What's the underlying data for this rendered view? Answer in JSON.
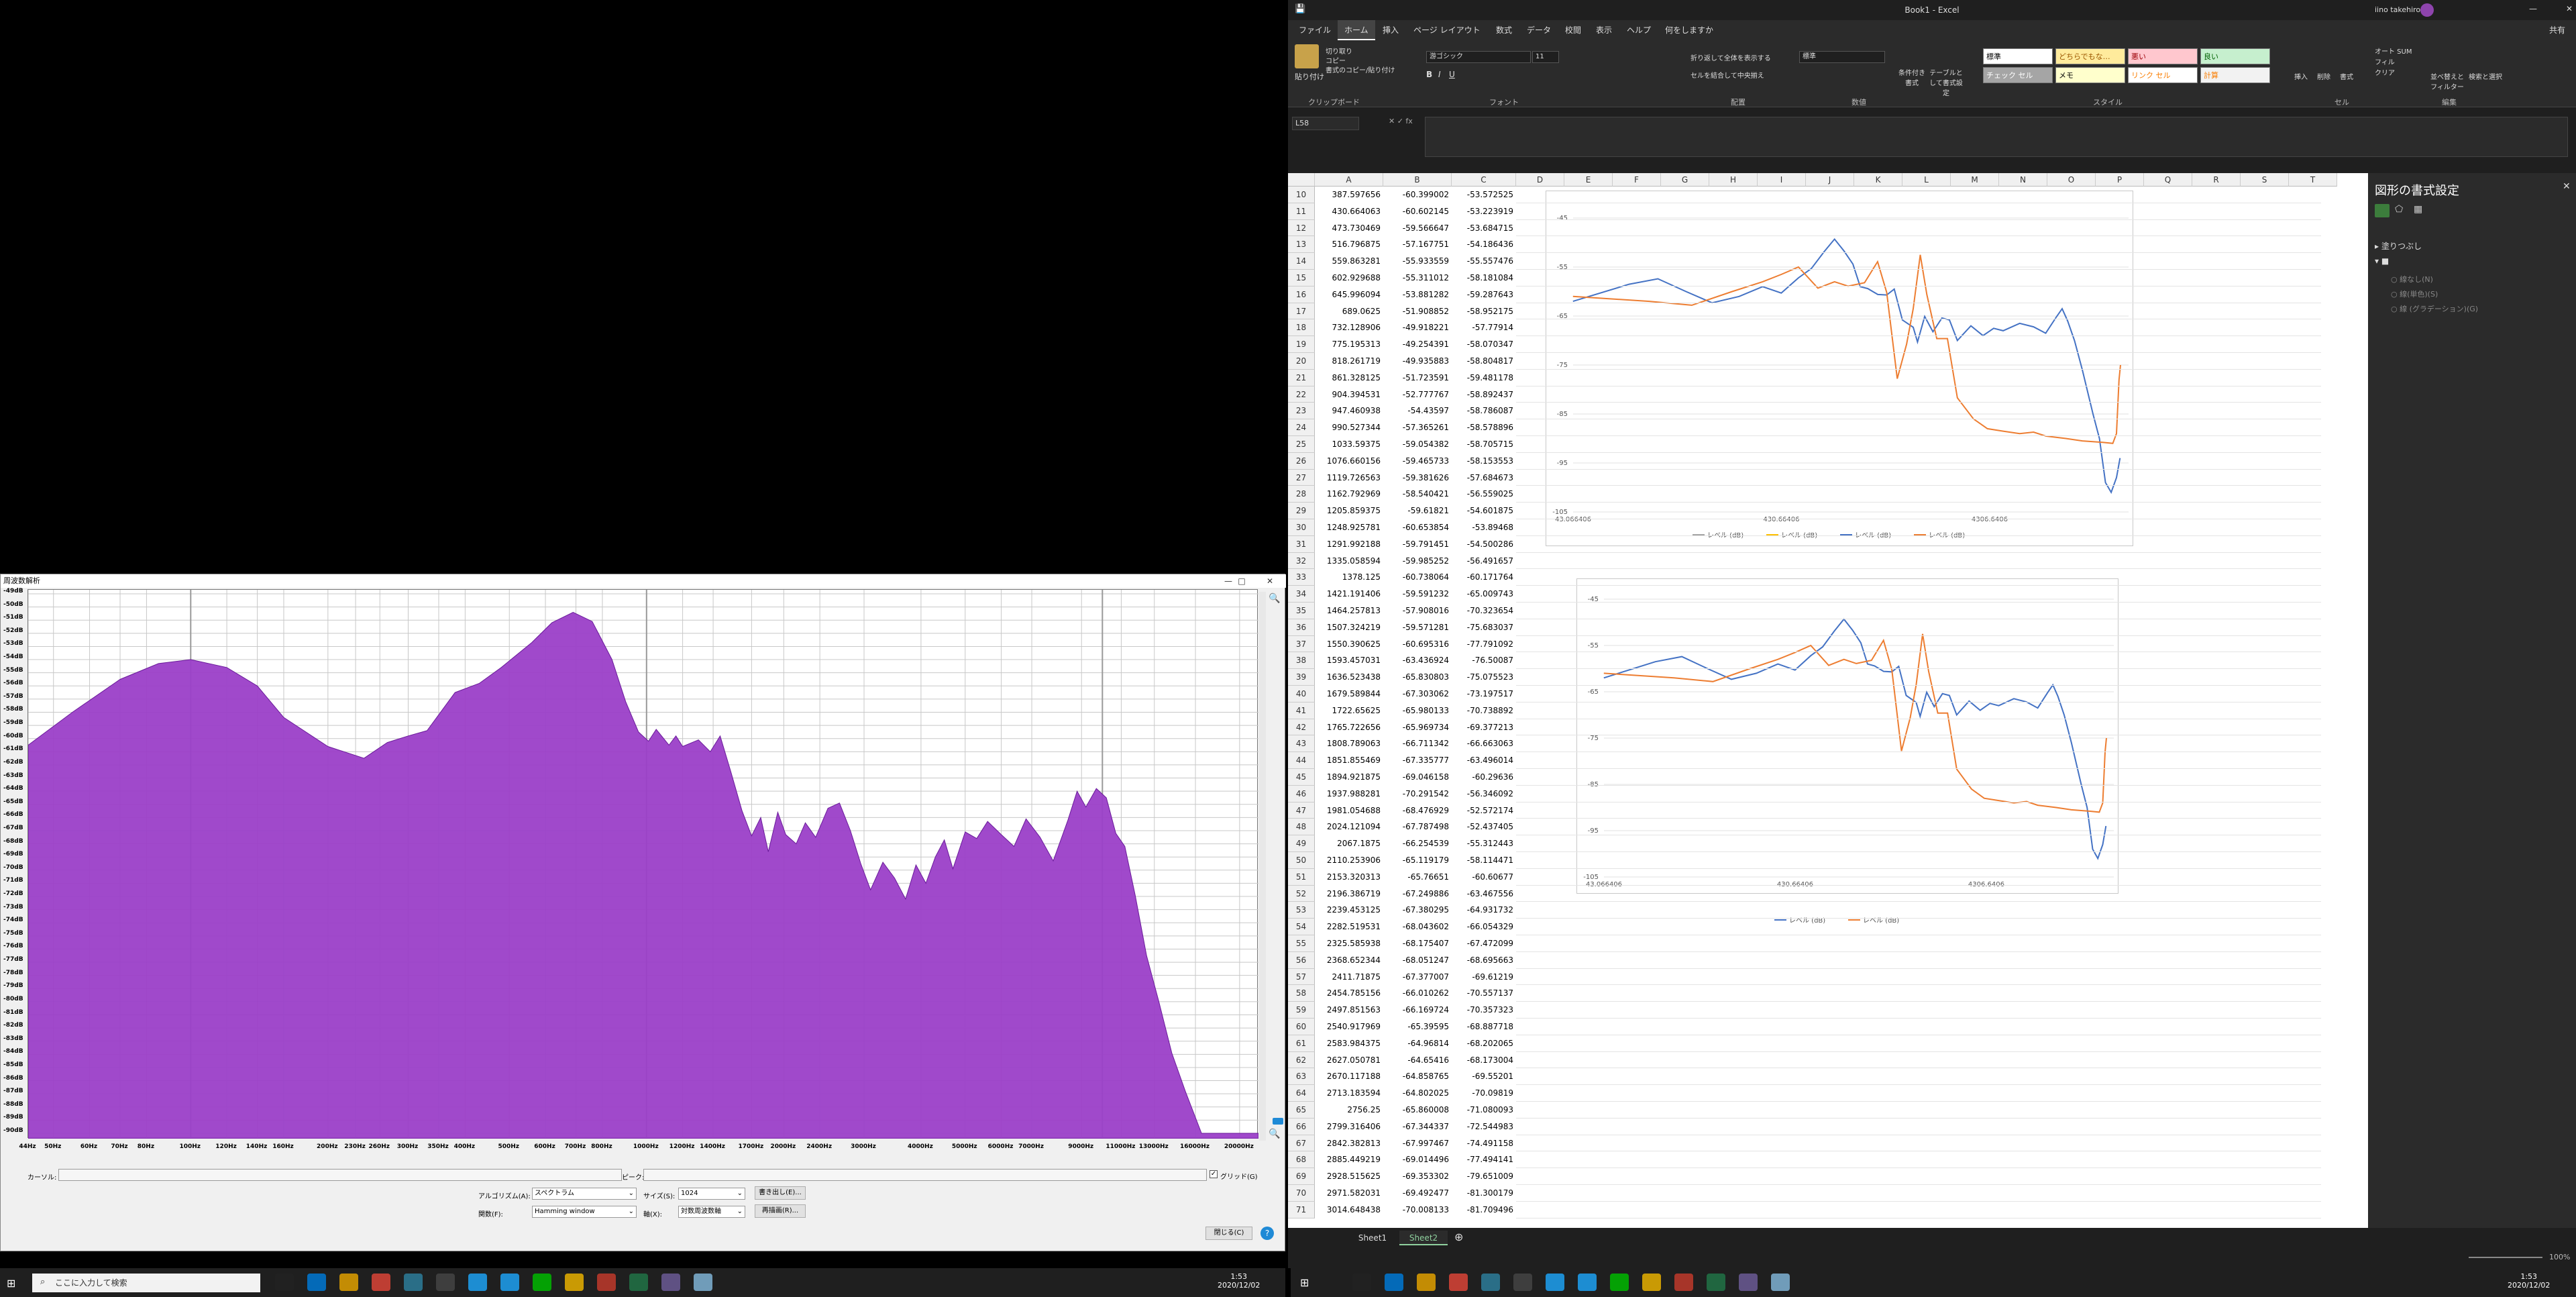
{
  "analysis_window": {
    "title": "周波数解析",
    "y_labels": [
      "-49dB",
      "-50dB",
      "-51dB",
      "-52dB",
      "-53dB",
      "-54dB",
      "-55dB",
      "-56dB",
      "-57dB",
      "-58dB",
      "-59dB",
      "-60dB",
      "-61dB",
      "-62dB",
      "-63dB",
      "-64dB",
      "-65dB",
      "-66dB",
      "-67dB",
      "-68dB",
      "-69dB",
      "-70dB",
      "-71dB",
      "-72dB",
      "-73dB",
      "-74dB",
      "-75dB",
      "-76dB",
      "-77dB",
      "-78dB",
      "-79dB",
      "-80dB",
      "-81dB",
      "-82dB",
      "-83dB",
      "-84dB",
      "-85dB",
      "-86dB",
      "-87dB",
      "-88dB",
      "-89dB",
      "-90dB"
    ],
    "x_labels": [
      "44Hz",
      "50Hz",
      "60Hz",
      "70Hz",
      "80Hz",
      "100Hz",
      "120Hz",
      "140Hz",
      "160Hz",
      "200Hz",
      "230Hz",
      "260Hz",
      "300Hz",
      "350Hz",
      "400Hz",
      "500Hz",
      "600Hz",
      "700Hz",
      "800Hz",
      "1000Hz",
      "1200Hz",
      "1400Hz",
      "1700Hz",
      "2000Hz",
      "2400Hz",
      "3000Hz",
      "4000Hz",
      "5000Hz",
      "6000Hz",
      "7000Hz",
      "9000Hz",
      "11000Hz",
      "13000Hz",
      "16000Hz",
      "20000Hz"
    ],
    "cursor_label": "カーソル:",
    "peak_label": "ピーク:",
    "grid_label": "グリッド(G)",
    "algo_label": "アルゴリズム(A):",
    "algo_value": "スペクトラム",
    "size_label": "サイズ(S):",
    "size_value": "1024",
    "export_button": "書き出し(E)...",
    "func_label": "関数(F):",
    "func_value": "Hamming window",
    "axis_label": "軸(X):",
    "axis_value": "対数周波数軸",
    "replot_button": "再描画(R)...",
    "close_button": "閉じる(C)",
    "help_button": "?",
    "accent": "#9b3fc8"
  },
  "taskbar_left": {
    "search": "ここに入力して検索",
    "time": "1:53",
    "date": "2020/12/02"
  },
  "taskbar_right": {
    "time": "1:53",
    "date": "2020/12/02"
  },
  "excel": {
    "title": "Book1 - Excel",
    "user": "iino takehiro",
    "tabs": [
      "ファイル",
      "ホーム",
      "挿入",
      "ページ レイアウト",
      "数式",
      "データ",
      "校閲",
      "表示",
      "ヘルプ",
      "何をしますか"
    ],
    "share": "共有",
    "ribbon": {
      "paste": "貼り付け",
      "cut": "切り取り",
      "copy": "コピー",
      "format_painter": "書式のコピー/貼り付け",
      "font_name": "游ゴシック",
      "font_size": "11",
      "wrap": "折り返して全体を表示する",
      "merge": "セルを結合して中央揃え",
      "number_format": "標準",
      "cond_format": "条件付き書式",
      "table_format": "テーブルとして書式設定",
      "styles": [
        "標準",
        "どちらでもな…",
        "悪い",
        "良い",
        "チェック セル",
        "メモ",
        "リンク セル",
        "計算"
      ],
      "insert": "挿入",
      "delete": "削除",
      "format": "書式",
      "autosum": "オート SUM",
      "fill": "フィル",
      "clear": "クリア",
      "sort": "並べ替えとフィルター",
      "find": "検索と選択",
      "groups": [
        "クリップボード",
        "フォント",
        "配置",
        "数値",
        "スタイル",
        "セル",
        "編集"
      ]
    },
    "name_box": "L58",
    "columns": [
      "A",
      "B",
      "C",
      "D",
      "E",
      "F",
      "G",
      "H",
      "I",
      "J",
      "K",
      "L",
      "M",
      "N",
      "O",
      "P",
      "Q",
      "R",
      "S",
      "T"
    ],
    "rows": [
      [
        "10",
        "387.597656",
        "-60.399002",
        "-53.572525"
      ],
      [
        "11",
        "430.664063",
        "-60.602145",
        "-53.223919"
      ],
      [
        "12",
        "473.730469",
        "-59.566647",
        "-53.684715"
      ],
      [
        "13",
        "516.796875",
        "-57.167751",
        "-54.186436"
      ],
      [
        "14",
        "559.863281",
        "-55.933559",
        "-55.557476"
      ],
      [
        "15",
        "602.929688",
        "-55.311012",
        "-58.181084"
      ],
      [
        "16",
        "645.996094",
        "-53.881282",
        "-59.287643"
      ],
      [
        "17",
        "689.0625",
        "-51.908852",
        "-58.952175"
      ],
      [
        "18",
        "732.128906",
        "-49.918221",
        "-57.77914"
      ],
      [
        "19",
        "775.195313",
        "-49.254391",
        "-58.070347"
      ],
      [
        "20",
        "818.261719",
        "-49.935883",
        "-58.804817"
      ],
      [
        "21",
        "861.328125",
        "-51.723591",
        "-59.481178"
      ],
      [
        "22",
        "904.394531",
        "-52.777767",
        "-58.892437"
      ],
      [
        "23",
        "947.460938",
        "-54.43597",
        "-58.786087"
      ],
      [
        "24",
        "990.527344",
        "-57.365261",
        "-58.578896"
      ],
      [
        "25",
        "1033.59375",
        "-59.054382",
        "-58.705715"
      ],
      [
        "26",
        "1076.660156",
        "-59.465733",
        "-58.153553"
      ],
      [
        "27",
        "1119.726563",
        "-59.381626",
        "-57.684673"
      ],
      [
        "28",
        "1162.792969",
        "-58.540421",
        "-56.559025"
      ],
      [
        "29",
        "1205.859375",
        "-59.61821",
        "-54.601875"
      ],
      [
        "30",
        "1248.925781",
        "-60.653854",
        "-53.89468"
      ],
      [
        "31",
        "1291.992188",
        "-59.791451",
        "-54.500286"
      ],
      [
        "32",
        "1335.058594",
        "-59.985252",
        "-56.491657"
      ],
      [
        "33",
        "1378.125",
        "-60.738064",
        "-60.171764"
      ],
      [
        "34",
        "1421.191406",
        "-59.591232",
        "-65.009743"
      ],
      [
        "35",
        "1464.257813",
        "-57.908016",
        "-70.323654"
      ],
      [
        "36",
        "1507.324219",
        "-59.571281",
        "-75.683037"
      ],
      [
        "37",
        "1550.390625",
        "-60.695316",
        "-77.791092"
      ],
      [
        "38",
        "1593.457031",
        "-63.436924",
        "-76.50087"
      ],
      [
        "39",
        "1636.523438",
        "-65.830803",
        "-75.075523"
      ],
      [
        "40",
        "1679.589844",
        "-67.303062",
        "-73.197517"
      ],
      [
        "41",
        "1722.65625",
        "-65.980133",
        "-70.738892"
      ],
      [
        "42",
        "1765.722656",
        "-65.969734",
        "-69.377213"
      ],
      [
        "43",
        "1808.789063",
        "-66.711342",
        "-66.663063"
      ],
      [
        "44",
        "1851.855469",
        "-67.335777",
        "-63.496014"
      ],
      [
        "45",
        "1894.921875",
        "-69.046158",
        "-60.29636"
      ],
      [
        "46",
        "1937.988281",
        "-70.291542",
        "-56.346092"
      ],
      [
        "47",
        "1981.054688",
        "-68.476929",
        "-52.572174"
      ],
      [
        "48",
        "2024.121094",
        "-67.787498",
        "-52.437405"
      ],
      [
        "49",
        "2067.1875",
        "-66.254539",
        "-55.312443"
      ],
      [
        "50",
        "2110.253906",
        "-65.119179",
        "-58.114471"
      ],
      [
        "51",
        "2153.320313",
        "-65.76651",
        "-60.60677"
      ],
      [
        "52",
        "2196.386719",
        "-67.249886",
        "-63.467556"
      ],
      [
        "53",
        "2239.453125",
        "-67.380295",
        "-64.931732"
      ],
      [
        "54",
        "2282.519531",
        "-68.043602",
        "-66.054329"
      ],
      [
        "55",
        "2325.585938",
        "-68.175407",
        "-67.472099"
      ],
      [
        "56",
        "2368.652344",
        "-68.051247",
        "-68.695663"
      ],
      [
        "57",
        "2411.71875",
        "-67.377007",
        "-69.61219"
      ],
      [
        "58",
        "2454.785156",
        "-66.010262",
        "-70.557137"
      ],
      [
        "59",
        "2497.851563",
        "-66.169724",
        "-70.357323"
      ],
      [
        "60",
        "2540.917969",
        "-65.39595",
        "-68.887718"
      ],
      [
        "61",
        "2583.984375",
        "-64.96814",
        "-68.202065"
      ],
      [
        "62",
        "2627.050781",
        "-64.65416",
        "-68.173004"
      ],
      [
        "63",
        "2670.117188",
        "-64.858765",
        "-69.55201"
      ],
      [
        "64",
        "2713.183594",
        "-64.802025",
        "-70.09819"
      ],
      [
        "65",
        "2756.25",
        "-65.860008",
        "-71.080093"
      ],
      [
        "66",
        "2799.316406",
        "-67.344337",
        "-72.544983"
      ],
      [
        "67",
        "2842.382813",
        "-67.997467",
        "-74.491158"
      ],
      [
        "68",
        "2885.449219",
        "-69.014496",
        "-77.494141"
      ],
      [
        "69",
        "2928.515625",
        "-69.353302",
        "-79.651009"
      ],
      [
        "70",
        "2971.582031",
        "-69.492477",
        "-81.300179"
      ],
      [
        "71",
        "3014.648438",
        "-70.008133",
        "-81.709496"
      ]
    ],
    "chart1": {
      "y_ticks": [
        "-45",
        "-55",
        "-65",
        "-75",
        "-85",
        "-95",
        "-105"
      ],
      "x_ticks": [
        "43.066406",
        "430.66406",
        "4306.6406"
      ],
      "legend": [
        "レベル (dB)",
        "レベル (dB)",
        "レベル (dB)",
        "レベル (dB)"
      ]
    },
    "chart2": {
      "y_ticks": [
        "-45",
        "-55",
        "-65",
        "-75",
        "-85",
        "-95",
        "-105"
      ],
      "x_ticks": [
        "43.066406",
        "430.66406",
        "4306.6406"
      ],
      "legend": [
        "レベル (dB)",
        "レベル (dB)"
      ]
    },
    "pane": {
      "title": "図形の書式設定",
      "section": "塗りつぶし",
      "options": [
        "線なし(N)",
        "線(単色)(S)",
        "線 (グラデーション)(G)"
      ]
    },
    "sheets": [
      "Sheet1",
      "Sheet2"
    ],
    "zoom": "100%",
    "colors": {
      "blue": "#4472c4",
      "orange": "#ed7d31",
      "gray": "#a5a5a5",
      "gold": "#ffc000",
      "excel_green": "#217346"
    }
  }
}
